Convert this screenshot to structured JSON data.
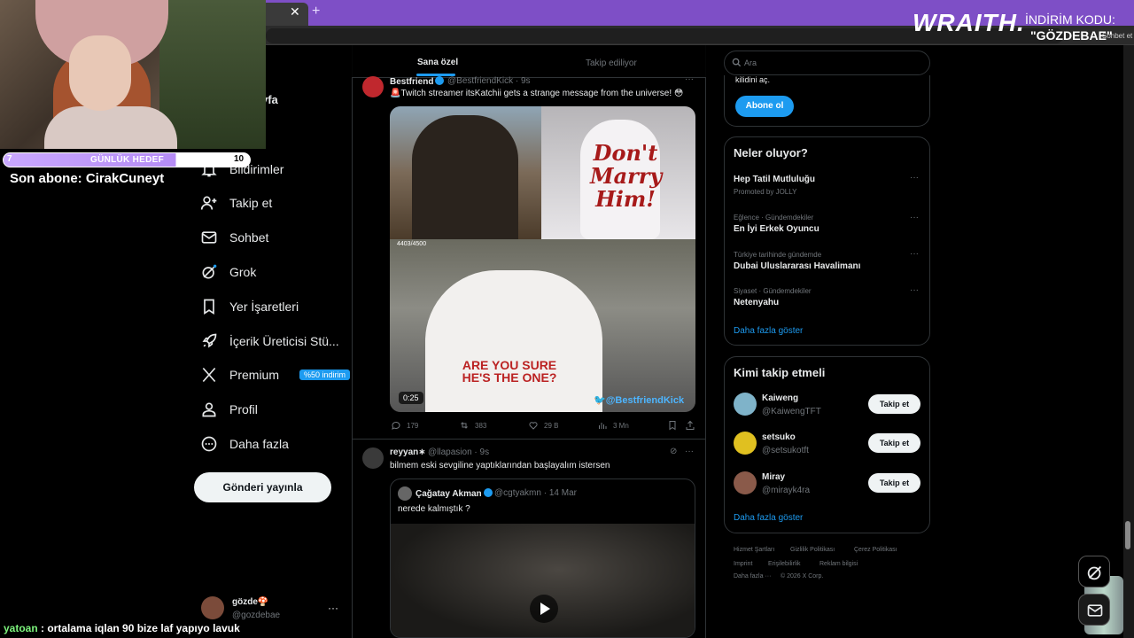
{
  "stream": {
    "goal_left": "7",
    "goal_label": "GÜNLÜK HEDEF",
    "goal_right": "10",
    "goal_progress": 0.7,
    "last_sub": "Son abone: CirakCuneyt",
    "chat_user": "yatoan",
    "chat_message": " : ortalama iqlan 90 bize laf yapıyo lavuk"
  },
  "promo": {
    "logo": "WRAITH.",
    "code_label": "İNDİRİM KODU:",
    "code_value": "\"GÖZDEBAE\"",
    "small": "Sohbet et"
  },
  "nav": {
    "partial_home": "yfa",
    "items": [
      {
        "label": "Bildirimler",
        "icon": "bell-icon"
      },
      {
        "label": "Takip et",
        "icon": "add-user-icon"
      },
      {
        "label": "Sohbet",
        "icon": "mail-icon"
      },
      {
        "label": "Grok",
        "icon": "grok-icon"
      },
      {
        "label": "Yer İşaretleri",
        "icon": "bookmark-icon"
      },
      {
        "label": "İçerik Üreticisi Stü...",
        "icon": "rocket-icon"
      },
      {
        "label": "Premium",
        "icon": "x-logo-icon",
        "badge": "%50 indirim"
      },
      {
        "label": "Profil",
        "icon": "person-icon"
      },
      {
        "label": "Daha fazla",
        "icon": "more-circle-icon"
      }
    ],
    "post_button": "Gönderi yayınla",
    "me_name": "gözde🍄",
    "me_handle": "@gozdebae"
  },
  "timeline": {
    "tab_foryou": "Sana özel",
    "tab_following": "Takip ediliyor",
    "tweet1": {
      "name": "Bestfriend",
      "handle": "@BestfriendKick · 9s",
      "text": "🚨Twitch streamer itsKatchii gets a strange message from the universe! 😳",
      "media_text_top": "Don't Marry Him!",
      "media_text_bottom": "ARE YOU SURE HE'S THE ONE?",
      "media_counter": "4403/4500",
      "duration": "0:25",
      "watermark": "🐦@BestfriendKick",
      "replies": "179",
      "reposts": "383",
      "likes": "29 B",
      "views": "3 Mn"
    },
    "tweet2": {
      "name": "reyyan∗",
      "handle": "@llapasion · 9s",
      "text": "bilmem eski sevgiline yaptıklarından başlayalım istersen",
      "quote_name": "Çağatay Akman",
      "quote_handle": "@cgtyakmn · 14 Mar",
      "quote_text": "nerede kalmıştık ?"
    }
  },
  "right": {
    "search_placeholder": "Ara",
    "subscribe_partial": "kilidini aç.",
    "subscribe_button": "Abone ol",
    "trends_title": "Neler oluyor?",
    "trends": [
      {
        "meta": "",
        "name": "Hep Tatil Mutluluğu",
        "sub": "Promoted by JOLLY"
      },
      {
        "meta": "Eğlence · Gündemdekiler",
        "name": "En İyi Erkek Oyuncu"
      },
      {
        "meta": "Türkiye tarihinde gündemde",
        "name": "Dubai Uluslararası Havalimanı"
      },
      {
        "meta": "Siyaset · Gündemdekiler",
        "name": "Netenyahu"
      }
    ],
    "show_more": "Daha fazla göster",
    "wtf_title": "Kimi takip etmeli",
    "wtf": [
      {
        "name": "Kaiweng",
        "handle": "@KaiwengTFT",
        "button": "Takip et",
        "color": "#7fb3c9"
      },
      {
        "name": "setsuko",
        "handle": "@setsukotft",
        "button": "Takip et",
        "color": "#e0c020"
      },
      {
        "name": "Miray",
        "handle": "@mirayk4ra",
        "button": "Takip et",
        "color": "#8a5a4a"
      }
    ],
    "wtf_more": "Daha fazla göster",
    "footer": {
      "l1": "Hizmet Şartları",
      "l2": "Gizlilik Politikası",
      "l3": "Çerez Politikası",
      "l4": "Imprint",
      "l5": "Erişilebilirlik",
      "l6": "Reklam bilgisi",
      "l7": "Daha fazla ···",
      "l8": "© 2026 X Corp."
    }
  },
  "colors": {
    "accent": "#1d9bf0",
    "tabbar": "#7e4fc6",
    "background": "#000000"
  }
}
